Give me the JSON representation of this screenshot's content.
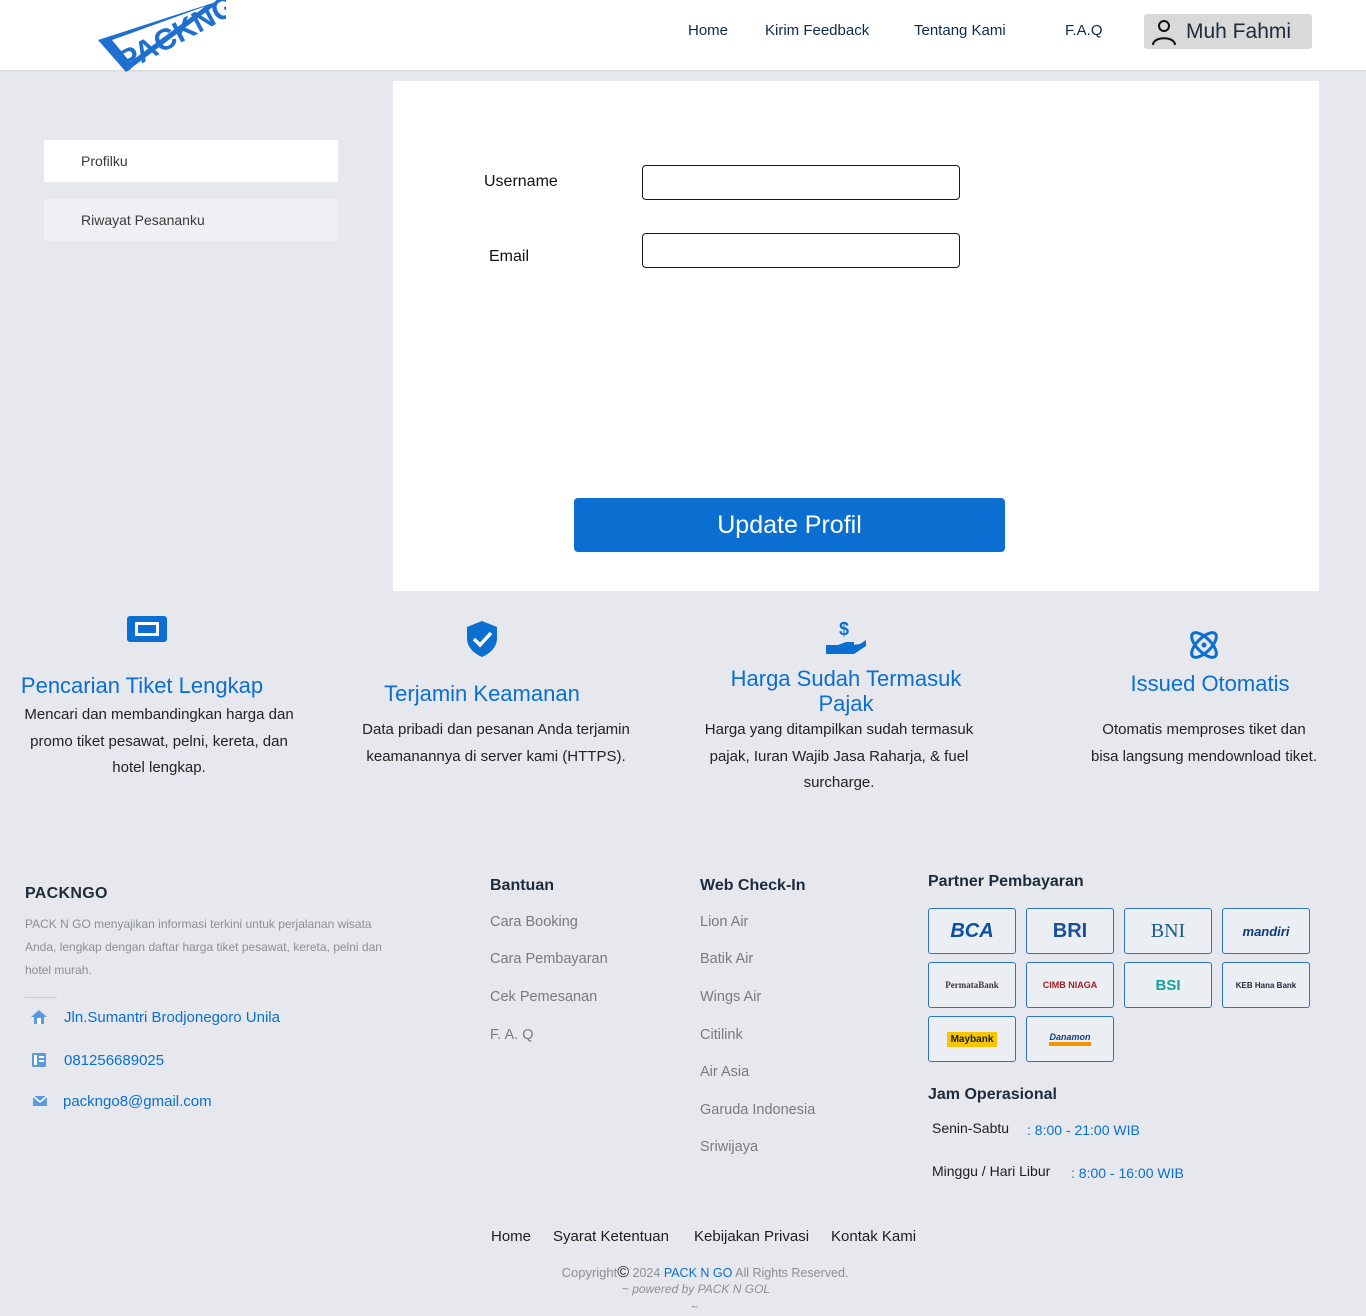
{
  "header": {
    "logo_text": "PACKNGO",
    "nav": [
      "Home",
      "Kirim Feedback",
      "Tentang Kami",
      "F.A.Q"
    ],
    "user_name": "Muh Fahmi"
  },
  "sidebar": {
    "items": [
      {
        "label": "Profilku"
      },
      {
        "label": "Riwayat Pesananku"
      }
    ]
  },
  "profile_form": {
    "username_label": "Username",
    "username_value": "",
    "email_label": "Email",
    "email_value": "",
    "submit_label": "Update Profil"
  },
  "features": [
    {
      "icon": "ticket-icon",
      "title": "Pencarian Tiket Lengkap",
      "desc_lines": [
        "Mencari dan membandingkan harga dan",
        "promo tiket pesawat, pelni, kereta, dan",
        "hotel lengkap."
      ]
    },
    {
      "icon": "shield-check-icon",
      "title": "Terjamin Keamanan",
      "desc_lines": [
        "Data pribadi dan pesanan Anda terjamin",
        "keamanannya di server kami (HTTPS)."
      ]
    },
    {
      "icon": "hand-money-icon",
      "title_lines": [
        "Harga Sudah Termasuk",
        "Pajak"
      ],
      "desc_lines": [
        "Harga yang ditampilkan sudah termasuk",
        "pajak, Iuran Wajib Jasa Raharja, & fuel",
        "surcharge."
      ]
    },
    {
      "icon": "atom-icon",
      "title": "Issued Otomatis",
      "desc_lines": [
        "Otomatis memproses tiket dan",
        "bisa langsung mendownload tiket."
      ]
    }
  ],
  "footer": {
    "brand": "PACKNGO",
    "description_lines": [
      "PACK N GO menyajikan informasi terkini untuk perjalanan wisata",
      "Anda, lengkap dengan daftar harga tiket pesawat, kereta, pelni dan",
      "hotel murah."
    ],
    "contacts": [
      {
        "icon": "home-icon",
        "text": "Jln.Sumantri Brodjonegoro Unila"
      },
      {
        "icon": "phone-icon",
        "text": "081256689025"
      },
      {
        "icon": "mail-icon",
        "text": "packngo8@gmail.com"
      }
    ],
    "bantuan": {
      "title": "Bantuan",
      "links": [
        "Cara Booking",
        "Cara Pembayaran",
        "Cek Pemesanan",
        "F. A. Q"
      ]
    },
    "checkin": {
      "title": "Web Check-In",
      "links": [
        "Lion Air",
        "Batik Air",
        "Wings Air",
        "Citilink",
        "Air Asia",
        "Garuda Indonesia",
        "Sriwijaya"
      ]
    },
    "partners": {
      "title": "Partner Pembayaran",
      "banks": [
        "BCA",
        "BRI",
        "BNI",
        "mandiri",
        "PermataBank",
        "CIMB NIAGA",
        "BSI",
        "KEB Hana Bank",
        "Maybank",
        "Danamon"
      ]
    },
    "jam": {
      "title": "Jam Operasional",
      "rows": [
        {
          "day": "Senin-Sabtu",
          "time": ": 8:00 - 21:00 WIB"
        },
        {
          "day": "Minggu / Hari Libur",
          "time": ": 8:00 - 16:00 WIB"
        }
      ]
    },
    "bottom_links": [
      "Home",
      "Syarat Ketentuan",
      "Kebijakan Privasi",
      "Kontak Kami"
    ],
    "copyright_prefix": "Copyright",
    "copyright_symbol": "©",
    "copyright_year": " 2024 ",
    "copyright_brand": "PACK N GO",
    "copyright_suffix": " All Rights Reserved.",
    "powered": "~ powered by PACK N GOL",
    "tilde": "~"
  },
  "colors": {
    "accent": "#0a6fd1",
    "dark": "#1d2b3c",
    "background": "#e6e8ed"
  }
}
